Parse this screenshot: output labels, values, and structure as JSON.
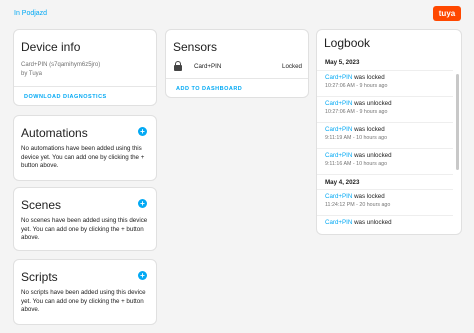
{
  "header": {
    "breadcrumb": "In Podjazd",
    "brand_logo": "tuya"
  },
  "device_info": {
    "title": "Device info",
    "model": "Card+PIN (s7qamihym6z5jro)",
    "manufacturer": "by Tuya",
    "download_label": "DOWNLOAD DIAGNOSTICS"
  },
  "sensors": {
    "title": "Sensors",
    "rows": [
      {
        "icon": "lock-icon",
        "name": "Card+PIN",
        "state": "Locked"
      }
    ],
    "add_label": "ADD TO DASHBOARD"
  },
  "automations": {
    "title": "Automations",
    "description": "No automations have been added using this device yet. You can add one by clicking the + button above."
  },
  "scenes": {
    "title": "Scenes",
    "description": "No scenes have been added using this device yet. You can add one by clicking the + button above."
  },
  "scripts": {
    "title": "Scripts",
    "description": "No scripts have been added using this device yet. You can add one by clicking the + button above."
  },
  "logbook": {
    "title": "Logbook",
    "days": [
      {
        "date": "May 5, 2023",
        "entries": [
          {
            "entity": "Card+PIN",
            "action": " was locked",
            "time": "10:27:06 AM",
            "ago": "9 hours ago"
          },
          {
            "entity": "Card+PIN",
            "action": " was unlocked",
            "time": "10:27:06 AM",
            "ago": "9 hours ago"
          },
          {
            "entity": "Card+PIN",
            "action": " was locked",
            "time": "9:11:19 AM",
            "ago": "10 hours ago"
          },
          {
            "entity": "Card+PIN",
            "action": " was unlocked",
            "time": "9:11:16 AM",
            "ago": "10 hours ago"
          }
        ]
      },
      {
        "date": "May 4, 2023",
        "entries": [
          {
            "entity": "Card+PIN",
            "action": " was locked",
            "time": "11:24:12 PM",
            "ago": "20 hours ago"
          },
          {
            "entity": "Card+PIN",
            "action": " was unlocked",
            "time": "",
            "ago": ""
          }
        ]
      }
    ]
  },
  "colors": {
    "accent": "#03a9f4",
    "brand": "#ff4800",
    "background": "#f4f4f4"
  }
}
